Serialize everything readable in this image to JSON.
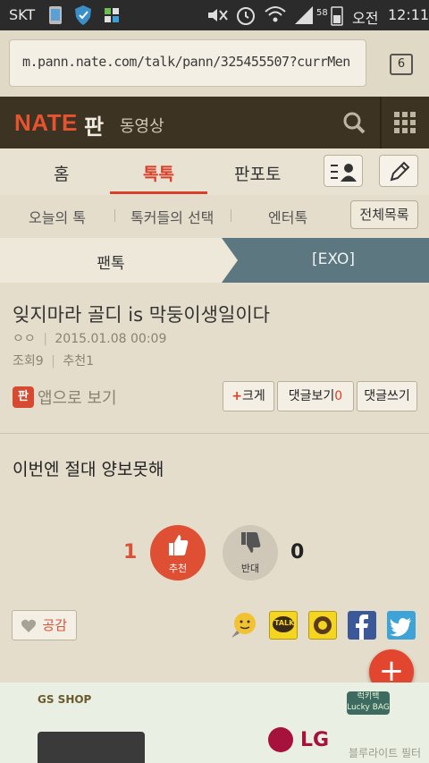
{
  "status_bar": {
    "carrier": "SKT",
    "battery": "58",
    "ampm": "오전",
    "time": "12:11"
  },
  "url_bar": {
    "url": "m.pann.nate.com/talk/pann/325455507?currMen",
    "tab_count": "6"
  },
  "header": {
    "logo": "NATE",
    "section": "판",
    "video": "동영상"
  },
  "tabs": [
    {
      "label": "홈",
      "active": false
    },
    {
      "label": "톡톡",
      "active": true
    },
    {
      "label": "판포토",
      "active": false
    }
  ],
  "subnav": {
    "items": [
      "오늘의 톡",
      "톡커들의 선택",
      "엔터톡"
    ],
    "all_label": "전체목록"
  },
  "breadcrumb": {
    "left": "팬톡",
    "right": "[EXO]"
  },
  "post": {
    "title": "잊지마라 골디 is 막둥이생일이다",
    "author": "ㅇㅇ",
    "date": "2015.01.08 00:09",
    "views_label": "조회",
    "views": "9",
    "recommend_label": "추천",
    "recommend": "1",
    "app_icon": "판",
    "app_view": "앱으로 보기",
    "font_plus": "+",
    "font_label": "크게",
    "comments_view_label": "댓글보기",
    "comments_count": "0",
    "write_comment": "댓글쓰기",
    "body": "이번엔 절대 양보못해"
  },
  "votes": {
    "up_count": "1",
    "up_label": "추천",
    "down_count": "0",
    "down_label": "반대"
  },
  "share": {
    "empathy_label": "공감",
    "icons": [
      "emoticon-icon",
      "kakaotalk-icon",
      "kakaostory-icon",
      "facebook-icon",
      "twitter-icon"
    ],
    "talk_text": "TALK"
  },
  "fab": {
    "symbol": "+"
  },
  "ad": {
    "shop": "GS SHOP",
    "lucky_bag": "럭키백 Lucky BAG",
    "lg": "LG",
    "watermark": "블루라이트 필터"
  },
  "colors": {
    "accent": "#de4f34",
    "header_bg": "#3c3323",
    "page_bg": "#e4ddcb"
  }
}
